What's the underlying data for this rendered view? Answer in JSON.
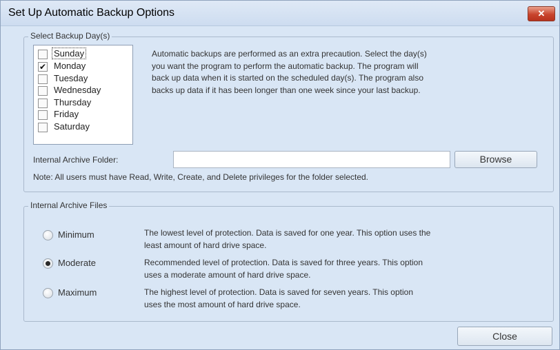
{
  "window": {
    "title": "Set Up Automatic Backup Options",
    "close_glyph": "✕"
  },
  "backup_day": {
    "legend": "Select Backup Day(s)",
    "days": [
      {
        "label": "Sunday",
        "checked": false
      },
      {
        "label": "Monday",
        "checked": true
      },
      {
        "label": "Tuesday",
        "checked": false
      },
      {
        "label": "Wednesday",
        "checked": false
      },
      {
        "label": "Thursday",
        "checked": false
      },
      {
        "label": "Friday",
        "checked": false
      },
      {
        "label": "Saturday",
        "checked": false
      }
    ],
    "description": [
      "Automatic backups are performed as an extra precaution. Select the day(s)",
      "you want the program to perform the automatic backup.  The program will",
      "back up data when it is started on the scheduled day(s). The program also",
      "backs up data if it has been longer than one week since your last backup."
    ],
    "folder_label": "Internal Archive Folder:",
    "folder_value": "",
    "browse_label": "Browse",
    "note": "Note:  All users must have Read, Write, Create, and Delete privileges for the folder selected."
  },
  "archive_files": {
    "legend": "Internal Archive Files",
    "options": [
      {
        "label": "Minimum",
        "selected": false,
        "desc": [
          "The lowest level of protection. Data is saved for one year. This option uses the",
          "least amount of hard drive space."
        ]
      },
      {
        "label": "Moderate",
        "selected": true,
        "desc": [
          "Recommended level of protection. Data is saved for three years. This option",
          "uses a moderate amount of hard drive space."
        ]
      },
      {
        "label": "Maximum",
        "selected": false,
        "desc": [
          "The highest level of protection. Data is saved for seven years. This option",
          "uses the most amount of hard drive space."
        ]
      }
    ]
  },
  "footer": {
    "close_label": "Close"
  }
}
